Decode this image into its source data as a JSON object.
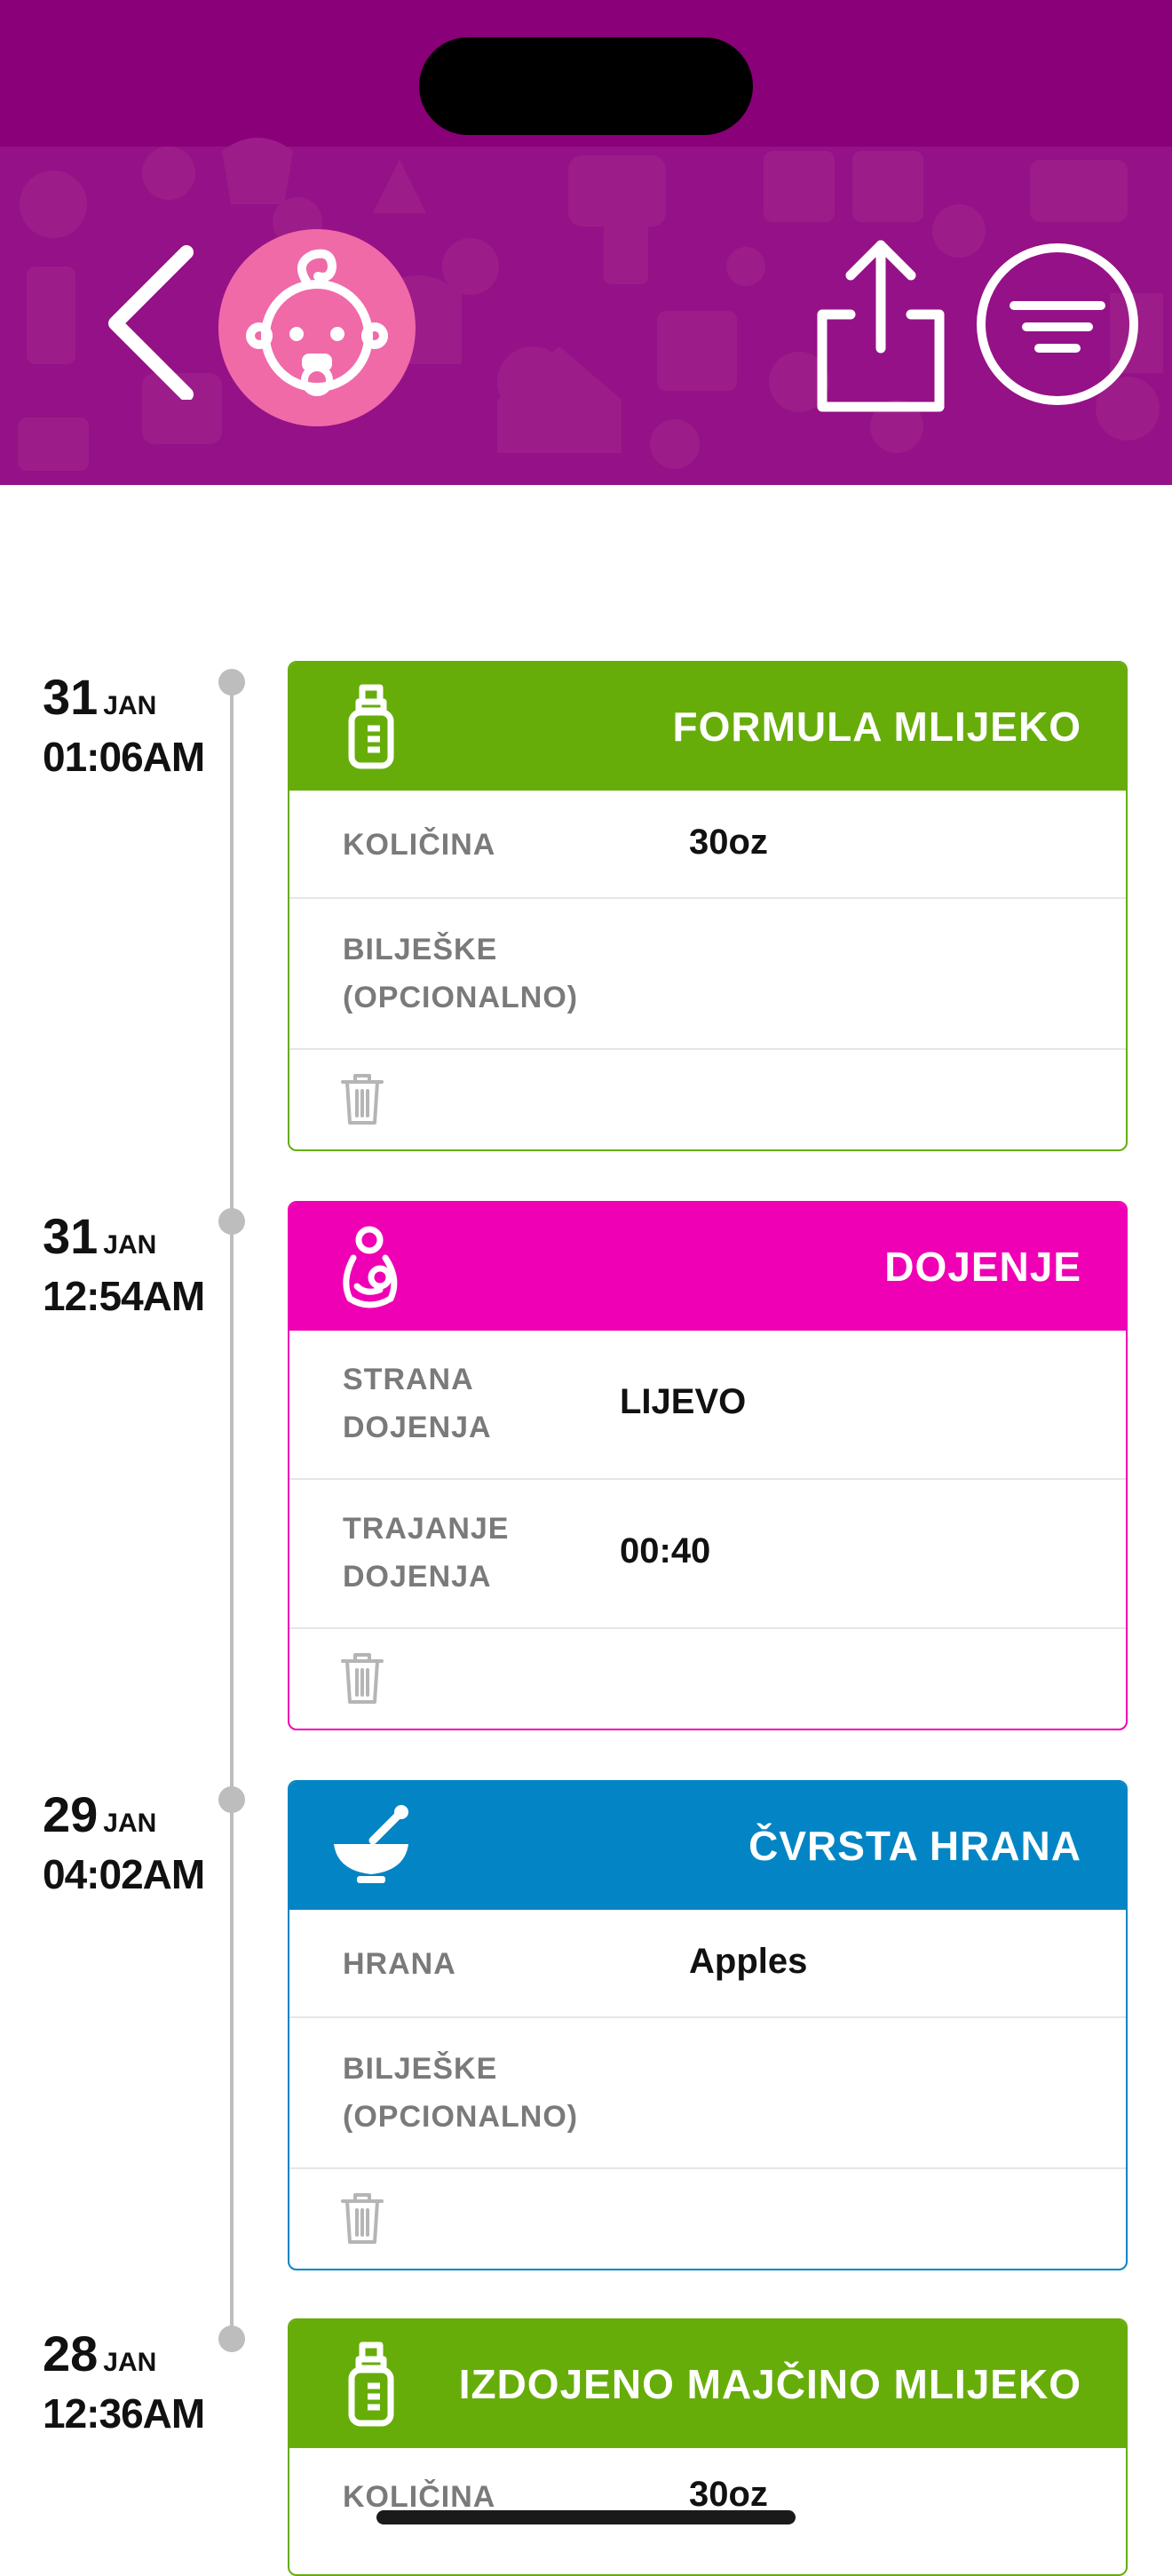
{
  "header": {
    "avatar_icon": "baby-face-icon",
    "back_icon": "chevron-left-icon",
    "share_icon": "share-icon",
    "filter_icon": "filter-icon",
    "colors": {
      "background": "#8a0078",
      "avatar": "#f06aa8"
    }
  },
  "entries": [
    {
      "day": "31",
      "month": "JAN",
      "time": "01:06AM",
      "title": "FORMULA MLIJEKO",
      "icon": "bottle-icon",
      "color": "#66ad0a",
      "rows": [
        {
          "label_lines": [
            "KOLIČINA"
          ],
          "value": "30oz"
        },
        {
          "label_lines": [
            "BILJEŠKE",
            "(OPCIONALNO)"
          ],
          "value": ""
        }
      ]
    },
    {
      "day": "31",
      "month": "JAN",
      "time": "12:54AM",
      "title": "DOJENJE",
      "icon": "breastfeeding-icon",
      "color": "#f000b4",
      "rows": [
        {
          "label_lines": [
            "STRANA",
            "DOJENJA"
          ],
          "value": "LIJEVO"
        },
        {
          "label_lines": [
            "TRAJANJE",
            "DOJENJA"
          ],
          "value": "00:40"
        }
      ]
    },
    {
      "day": "29",
      "month": "JAN",
      "time": "04:02AM",
      "title": "ČVRSTA HRANA",
      "icon": "mortar-bowl-icon",
      "color": "#0385c5",
      "rows": [
        {
          "label_lines": [
            "HRANA"
          ],
          "value": "Apples"
        },
        {
          "label_lines": [
            "BILJEŠKE",
            "(OPCIONALNO)"
          ],
          "value": ""
        }
      ]
    },
    {
      "day": "28",
      "month": "JAN",
      "time": "12:36AM",
      "title": "IZDOJENO MAJČINO MLIJEKO",
      "icon": "bottle-icon",
      "color": "#66ad0a",
      "rows": [
        {
          "label_lines": [
            "KOLIČINA"
          ],
          "value": "30oz"
        }
      ]
    }
  ]
}
